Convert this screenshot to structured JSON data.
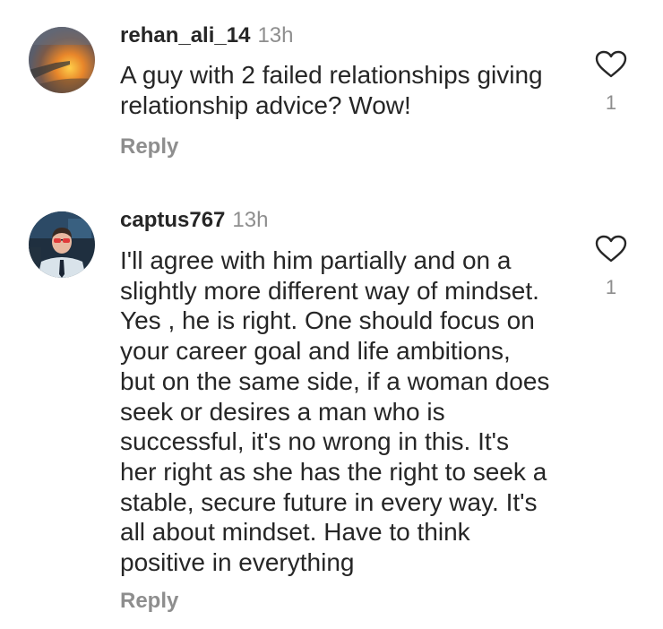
{
  "comments": [
    {
      "username": "rehan_ali_14",
      "time": "13h",
      "avatar_icon": "sunset-airplane-avatar",
      "text_lines": [
        "A guy with 2 failed relationships giving",
        "relationship advice? Wow!"
      ],
      "reply_label": "Reply",
      "like_icon": "heart-outline-icon",
      "like_count": "1"
    },
    {
      "username": "captus767",
      "time": "13h",
      "avatar_icon": "pilot-avatar",
      "text_lines": [
        "I'll agree with him partially and on a",
        "slightly more different way of mindset.",
        "Yes , he is right. One should focus on",
        "your career goal and life ambitions,",
        "but on the same side, if a woman does",
        "seek or desires a man who is",
        "successful, it's no wrong in this.  It's",
        "her right as she has the right to seek a",
        "stable, secure future in every way.  It's",
        "all about mindset. Have to think",
        "positive in everything"
      ],
      "reply_label": "Reply",
      "like_icon": "heart-outline-icon",
      "like_count": "1"
    }
  ],
  "colors": {
    "primary_text": "#262626",
    "secondary_text": "#8e8e8e",
    "background": "#ffffff"
  }
}
